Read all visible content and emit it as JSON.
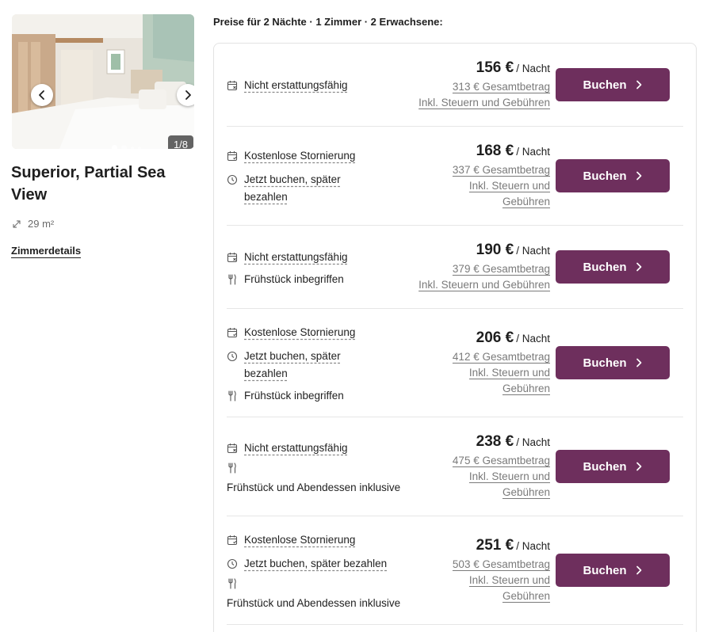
{
  "gallery": {
    "counter": "1/8",
    "prev_icon": "chevron-left-icon",
    "next_icon": "chevron-right-icon"
  },
  "room": {
    "name": "Superior, Partial Sea View",
    "size": "29 m²",
    "details_link": "Zimmerdetails"
  },
  "prices_header": "Preise für 2 Nächte · 1 Zimmer · 2 Erwachsene:",
  "colors": {
    "accent": "#6e2f5d",
    "text": "#1f1f1f",
    "muted": "#7a7a7a",
    "border": "#e3e3e3"
  },
  "rates": [
    {
      "cancellation": "Nicht erstattungsfähig",
      "price_night": "156 €",
      "per_night_label": "/ Nacht",
      "total": "313 € Gesamtbetrag",
      "tax_line1": "Inkl. Steuern und Gebühren",
      "book_label": "Buchen"
    },
    {
      "cancellation": "Kostenlose Stornierung",
      "pay_later_line1": "Jetzt buchen, später",
      "pay_later_line2": "bezahlen",
      "price_night": "168 €",
      "per_night_label": "/ Nacht",
      "total": "337 € Gesamtbetrag",
      "tax_line1": "Inkl. Steuern und",
      "tax_line2": "Gebühren",
      "book_label": "Buchen"
    },
    {
      "cancellation": "Nicht erstattungsfähig",
      "meal": "Frühstück inbegriffen",
      "price_night": "190 €",
      "per_night_label": "/ Nacht",
      "total": "379 € Gesamtbetrag",
      "tax_line1": "Inkl. Steuern und Gebühren",
      "book_label": "Buchen"
    },
    {
      "cancellation": "Kostenlose Stornierung",
      "pay_later_line1": "Jetzt buchen, später",
      "pay_later_line2": "bezahlen",
      "meal": "Frühstück inbegriffen",
      "price_night": "206 €",
      "per_night_label": "/ Nacht",
      "total": "412 € Gesamtbetrag",
      "tax_line1": "Inkl. Steuern und",
      "tax_line2": "Gebühren",
      "book_label": "Buchen"
    },
    {
      "cancellation": "Nicht erstattungsfähig",
      "meal": "Frühstück und Abendessen inklusive",
      "price_night": "238 €",
      "per_night_label": "/ Nacht",
      "total": "475 € Gesamtbetrag",
      "tax_line1": "Inkl. Steuern und",
      "tax_line2": "Gebühren",
      "book_label": "Buchen"
    },
    {
      "cancellation": "Kostenlose Stornierung",
      "pay_later_line1": "Jetzt buchen, später bezahlen",
      "meal": "Frühstück und Abendessen inklusive",
      "price_night": "251 €",
      "per_night_label": "/ Nacht",
      "total": "503 € Gesamtbetrag",
      "tax_line1": "Inkl. Steuern und",
      "tax_line2": "Gebühren",
      "book_label": "Buchen"
    }
  ]
}
